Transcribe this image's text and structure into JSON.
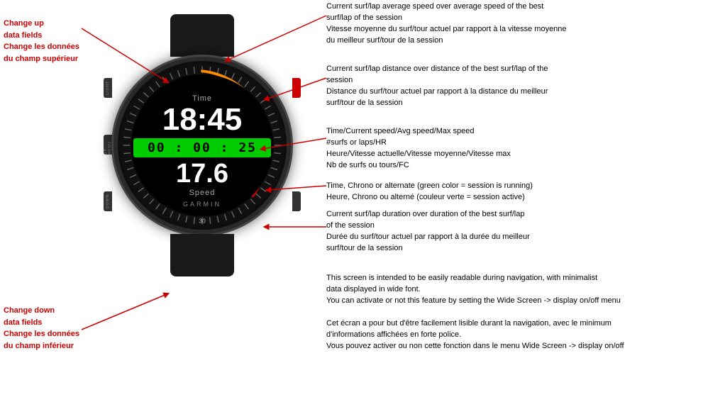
{
  "watch": {
    "label_top": "Time",
    "time": "18:45",
    "chrono": "00 : 00 : 25",
    "speed": "17.6",
    "label_bottom": "Speed",
    "brand": "GARMIN",
    "buttons": {
      "light": "LIGHT",
      "up_menu": "UP-MENU",
      "down": "DOWN"
    }
  },
  "left_annotations": {
    "top_line1": "Change up",
    "top_line2": "data fields",
    "top_line3": "Change les données",
    "top_line4": "du champ supérieur",
    "bottom_line1": "Change down",
    "bottom_line2": "data fields",
    "bottom_line3": "Change les données",
    "bottom_line4": "du champ inférieur"
  },
  "right_annotations": {
    "block1_line1": "Current surf/lap average speed over average speed of the best",
    "block1_line2": "surf/lap of the session",
    "block1_line3": "Vitesse moyenne du surf/tour actuel par rapport à la vitesse moyenne",
    "block1_line4": "du meilleur surf/tour de la session",
    "block2_line1": "Current surf/lap distance over distance of the best surf/lap of the",
    "block2_line2": "session",
    "block2_line3": "Distance du surf/tour actuel par rapport à la distance du meilleur",
    "block2_line4": "surf/tour de la session",
    "block3_line1": "Time/Current speed/Avg speed/Max speed",
    "block3_line2": "#surfs or laps/HR",
    "block3_line3": "Heure/Vitesse actuelle/Vitesse moyenne/Vitesse max",
    "block3_line4": "Nb de surfs ou tours/FC",
    "block4_line1": "Time, Chrono or alternate (green color = session is running)",
    "block4_line2": "Heure, Chrono ou alterné (couleur verte = session active)",
    "block5_line1": "Current surf/lap duration over duration  of the best surf/lap",
    "block5_line2": "of the session",
    "block5_line3": "Durée du surf/tour actuel par rapport à la durée du meilleur",
    "block5_line4": "surf/tour de la session",
    "block6_line1": "This screen is intended to be easily readable during navigation, with minimalist",
    "block6_line2": "data displayed in wide font.",
    "block6_line3": "You can activate or not this feature by setting the Wide Screen -> display on/off menu",
    "block6_line4": "",
    "block6_line5": "Cet écran a pour but d'être facilement lisible durant la navigation, avec le minimum",
    "block6_line6": "d'informations affichées en forte police.",
    "block6_line7": "Vous pouvez activer ou non cette fonction dans le menu Wide Screen -> display on/off"
  }
}
